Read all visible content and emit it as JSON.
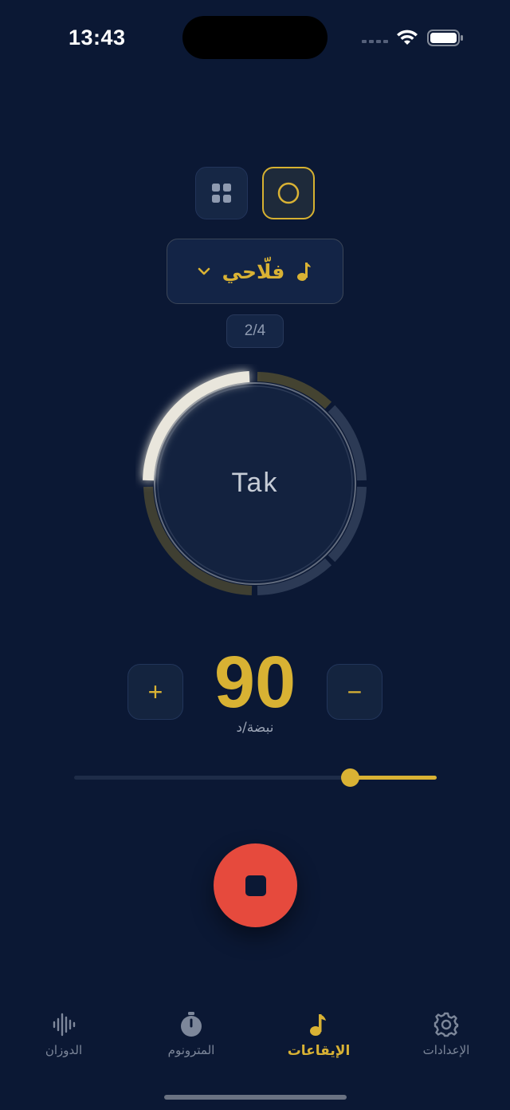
{
  "status_bar": {
    "time": "13:43"
  },
  "view_mode": {
    "grid_icon": "grid-icon",
    "circle_icon": "circle-icon",
    "active": "circle"
  },
  "rhythm": {
    "name": "فلّاحي",
    "icon": "music-note-icon",
    "dropdown_icon": "chevron-down-icon",
    "time_signature": "2/4"
  },
  "beat_display": {
    "current_label": "Tak"
  },
  "tempo": {
    "value": "90",
    "unit": "نبضة/د",
    "plus_label": "+",
    "minus_label": "−",
    "slider_level": 0.24
  },
  "playback": {
    "stop_icon": "stop-icon"
  },
  "tabs": [
    {
      "label": "الدوزان",
      "icon": "waveform-icon",
      "active": false
    },
    {
      "label": "المترونوم",
      "icon": "stopwatch-icon",
      "active": false
    },
    {
      "label": "الإيقاعات",
      "icon": "music-note-icon",
      "active": true
    },
    {
      "label": "الإعدادات",
      "icon": "gear-icon",
      "active": false
    }
  ],
  "colors": {
    "background": "#0b1834",
    "accent": "#d9b234",
    "stop": "#e64a3d"
  }
}
